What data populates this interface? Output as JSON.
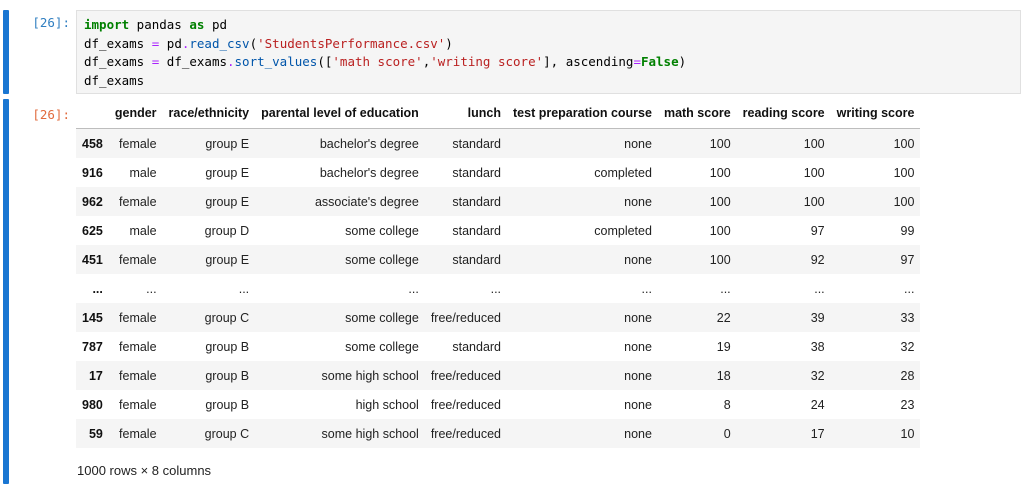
{
  "input_cell": {
    "prompt": "[26]:",
    "lines": [
      [
        {
          "t": "kw",
          "v": "import"
        },
        {
          "t": "",
          "v": " pandas "
        },
        {
          "t": "kw",
          "v": "as"
        },
        {
          "t": "",
          "v": " pd"
        }
      ],
      [
        {
          "t": "",
          "v": "df_exams "
        },
        {
          "t": "op",
          "v": "="
        },
        {
          "t": "",
          "v": " pd"
        },
        {
          "t": "op",
          "v": "."
        },
        {
          "t": "fn",
          "v": "read_csv"
        },
        {
          "t": "",
          "v": "("
        },
        {
          "t": "str",
          "v": "'StudentsPerformance.csv'"
        },
        {
          "t": "",
          "v": ")"
        }
      ],
      [
        {
          "t": "",
          "v": "df_exams "
        },
        {
          "t": "op",
          "v": "="
        },
        {
          "t": "",
          "v": " df_exams"
        },
        {
          "t": "op",
          "v": "."
        },
        {
          "t": "fn",
          "v": "sort_values"
        },
        {
          "t": "",
          "v": "(["
        },
        {
          "t": "str",
          "v": "'math score'"
        },
        {
          "t": "",
          "v": ","
        },
        {
          "t": "str",
          "v": "'writing score'"
        },
        {
          "t": "",
          "v": "], ascending"
        },
        {
          "t": "op",
          "v": "="
        },
        {
          "t": "fl",
          "v": "False"
        },
        {
          "t": "",
          "v": ")"
        }
      ],
      [
        {
          "t": "",
          "v": "df_exams"
        }
      ]
    ]
  },
  "output_cell": {
    "prompt": "[26]:",
    "columns": [
      "",
      "gender",
      "race/ethnicity",
      "parental level of education",
      "lunch",
      "test preparation course",
      "math score",
      "reading score",
      "writing score"
    ],
    "rows": [
      [
        "458",
        "female",
        "group E",
        "bachelor's degree",
        "standard",
        "none",
        "100",
        "100",
        "100"
      ],
      [
        "916",
        "male",
        "group E",
        "bachelor's degree",
        "standard",
        "completed",
        "100",
        "100",
        "100"
      ],
      [
        "962",
        "female",
        "group E",
        "associate's degree",
        "standard",
        "none",
        "100",
        "100",
        "100"
      ],
      [
        "625",
        "male",
        "group D",
        "some college",
        "standard",
        "completed",
        "100",
        "97",
        "99"
      ],
      [
        "451",
        "female",
        "group E",
        "some college",
        "standard",
        "none",
        "100",
        "92",
        "97"
      ],
      [
        "...",
        "...",
        "...",
        "...",
        "...",
        "...",
        "...",
        "...",
        "..."
      ],
      [
        "145",
        "female",
        "group C",
        "some college",
        "free/reduced",
        "none",
        "22",
        "39",
        "33"
      ],
      [
        "787",
        "female",
        "group B",
        "some college",
        "standard",
        "none",
        "19",
        "38",
        "32"
      ],
      [
        "17",
        "female",
        "group B",
        "some high school",
        "free/reduced",
        "none",
        "18",
        "32",
        "28"
      ],
      [
        "980",
        "female",
        "group B",
        "high school",
        "free/reduced",
        "none",
        "8",
        "24",
        "23"
      ],
      [
        "59",
        "female",
        "group C",
        "some high school",
        "free/reduced",
        "none",
        "0",
        "17",
        "10"
      ]
    ],
    "shape_text": "1000 rows × 8 columns"
  },
  "colors": {
    "cell_bar": "#1976d2",
    "prompt": "#307fc1",
    "keyword": "#008000",
    "string": "#ba2121",
    "operator": "#aa22ff",
    "row_stripe": "#f5f5f5"
  }
}
